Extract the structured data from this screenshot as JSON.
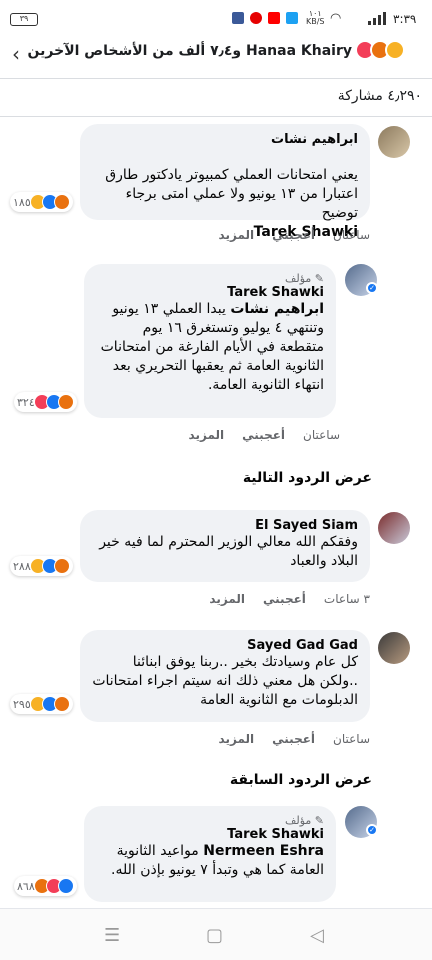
{
  "status_bar": {
    "time": "٣:٣٩",
    "battery": "٣٩",
    "speed_top": "١٠١",
    "speed_unit": "KB/S",
    "icons": [
      "twitter-icon",
      "youtube-icon",
      "vodafone-icon",
      "facebook-icon"
    ]
  },
  "header": {
    "reactors_text": "Hanaa Khairy و٧٫٤ ألف من الأشخاص الآخرين",
    "reactions": [
      "angry",
      "love",
      "sad"
    ]
  },
  "shares": "٤٫٢٩٠ مشاركة",
  "comments": [
    {
      "name": "ابراهيم نشات",
      "text": "يعني امتحانات العملي كمبيوتر يادكتور طارق اعتبارا من ١٣ يونيو ولا عملي امتى برجاء توضيح",
      "mention": "Tarek Shawki",
      "time": "ساعتان",
      "like": "أعجبني",
      "more": "المزيد",
      "reaction_count": "١٨٥"
    },
    {
      "badge": "مؤلف",
      "name": "Tarek Shawki",
      "mention": "ابراهيم نشات",
      "text": " يبدا العملي ١٣ يونيو وتنتهي ٤ يوليو وتستغرق ١٦ يوم متقطعة في الأيام الفارغة من امتحانات الثانوية العامة ثم يعقبها التحريري بعد انتهاء الثانوية العامة.",
      "time": "ساعتان",
      "like": "أعجبني",
      "more": "المزيد",
      "reaction_count": "٣٢٤"
    },
    {
      "name": "El Sayed Siam",
      "text": "وفقكم الله معالي الوزير المحترم لما فيه خير البلاد والعباد",
      "time": "٣ ساعات",
      "like": "أعجبني",
      "more": "المزيد",
      "reaction_count": "٢٨٨"
    },
    {
      "name": "Sayed Gad Gad",
      "text": "كل عام وسيادتك بخير ..ربنا يوفق ابنائنا ..ولكن هل معني ذلك انه سيتم اجراء امتحانات الدبلومات مع الثانوية العامة",
      "time": "ساعتان",
      "like": "أعجبني",
      "more": "المزيد",
      "reaction_count": "٢٩٥"
    },
    {
      "badge": "مؤلف",
      "name": "Tarek Shawki",
      "mention": "Nermeen Eshra",
      "text": " مواعيد الثانوية العامة كما هي وتبدأ ٧ يونيو بإذن الله.",
      "reaction_count": "٨٦٨"
    }
  ],
  "view_next_replies": "عرض الردود التالية",
  "view_previous_replies": "عرض الردود السابقة"
}
